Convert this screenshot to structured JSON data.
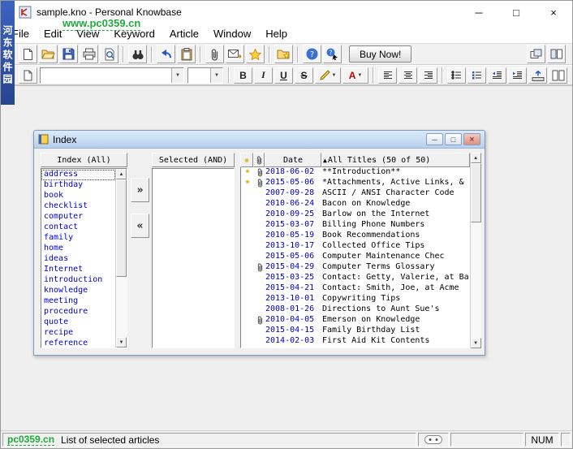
{
  "colors": {
    "link-blue": "#0000cc",
    "date-blue": "#0000bb",
    "star-gold": "#f2b200",
    "watermark-green": "#1faa3c",
    "banner-blue": "#27458f",
    "child-title-from": "#dcebfb",
    "child-title-to": "#b7cfec"
  },
  "icons": {
    "minimize": "─",
    "maximize": "□",
    "close": "×",
    "scroll-up": "▲",
    "scroll-down": "▼",
    "star": "★",
    "sort-asc": "▲",
    "dropdown": "▼"
  },
  "window": {
    "title": "sample.kno - Personal Knowbase"
  },
  "menu": {
    "items": [
      "File",
      "Edit",
      "View",
      "Keyword",
      "Article",
      "Window",
      "Help"
    ]
  },
  "toolbar": {
    "buy_now": "Buy Now!"
  },
  "format": {
    "font_value": "",
    "size_value": "",
    "bold": "B",
    "italic": "I",
    "underline": "U",
    "strike": "S",
    "font_color": "A"
  },
  "index_window": {
    "title": "Index",
    "available_header": "Index (All)",
    "selected_header": "Selected (AND)",
    "move_right": "»",
    "move_left": "«",
    "focused_index": 0,
    "keywords": [
      "address",
      "birthday",
      "book",
      "checklist",
      "computer",
      "contact",
      "family",
      "home",
      "ideas",
      "Internet",
      "introduction",
      "knowledge",
      "meeting",
      "procedure",
      "quote",
      "recipe",
      "reference"
    ],
    "table": {
      "date_header": "Date",
      "titles_header": "All Titles (50 of 50)",
      "rows": [
        {
          "star": true,
          "clip": true,
          "date": "2018-06-02",
          "title": "**Introduction**"
        },
        {
          "star": true,
          "clip": true,
          "date": "2015-05-06",
          "title": "*Attachments, Active Links, &"
        },
        {
          "star": false,
          "clip": false,
          "date": "2007-09-28",
          "title": "ASCII / ANSI Character Code"
        },
        {
          "star": false,
          "clip": false,
          "date": "2010-06-24",
          "title": "Bacon on Knowledge"
        },
        {
          "star": false,
          "clip": false,
          "date": "2010-09-25",
          "title": "Barlow on the Internet"
        },
        {
          "star": false,
          "clip": false,
          "date": "2015-03-07",
          "title": "Billing Phone Numbers"
        },
        {
          "star": false,
          "clip": false,
          "date": "2010-05-19",
          "title": "Book Recommendations"
        },
        {
          "star": false,
          "clip": false,
          "date": "2013-10-17",
          "title": "Collected Office Tips"
        },
        {
          "star": false,
          "clip": false,
          "date": "2015-05-06",
          "title": "Computer Maintenance Chec"
        },
        {
          "star": false,
          "clip": true,
          "date": "2015-04-29",
          "title": "Computer Terms Glossary"
        },
        {
          "star": false,
          "clip": false,
          "date": "2015-03-25",
          "title": "Contact: Getty, Valerie, at Ba"
        },
        {
          "star": false,
          "clip": false,
          "date": "2015-04-21",
          "title": "Contact: Smith, Joe, at Acme"
        },
        {
          "star": false,
          "clip": false,
          "date": "2013-10-01",
          "title": "Copywriting Tips"
        },
        {
          "star": false,
          "clip": false,
          "date": "2008-01-26",
          "title": "Directions to Aunt Sue's"
        },
        {
          "star": false,
          "clip": true,
          "date": "2010-04-05",
          "title": "Emerson on Knowledge"
        },
        {
          "star": false,
          "clip": false,
          "date": "2015-04-15",
          "title": "Family Birthday List"
        },
        {
          "star": false,
          "clip": false,
          "date": "2014-02-03",
          "title": "First Aid Kit Contents"
        }
      ]
    }
  },
  "statusbar": {
    "message": "List of selected articles",
    "num": "NUM"
  },
  "watermarks": {
    "banner": "河东软件园",
    "top_url": "www.pc0359.cn",
    "bottom_url": "pc0359.cn"
  }
}
